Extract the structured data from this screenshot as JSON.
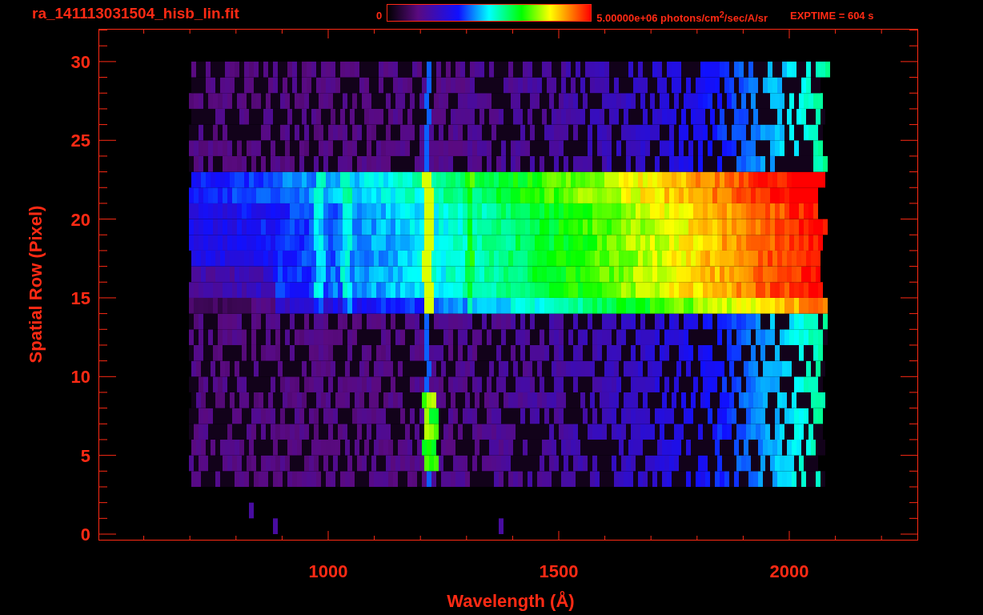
{
  "header": {
    "title": "ra_141113031504_hisb_lin.fit",
    "colorbar_min": "0",
    "colorbar_max": "5.00000e+06 photons/cm$^{2}$/sec/A/sr",
    "exposure": "EXPTIME = 604 s"
  },
  "plot": {
    "x_ticks": [
      "1000",
      "1500",
      "2000"
    ],
    "y_ticks": [
      "30",
      "25",
      "20",
      "15",
      "10",
      "5",
      "0"
    ],
    "xlabel": "Wavelength (Å)",
    "ylabel": "Spatial Row (Pixel)"
  }
}
